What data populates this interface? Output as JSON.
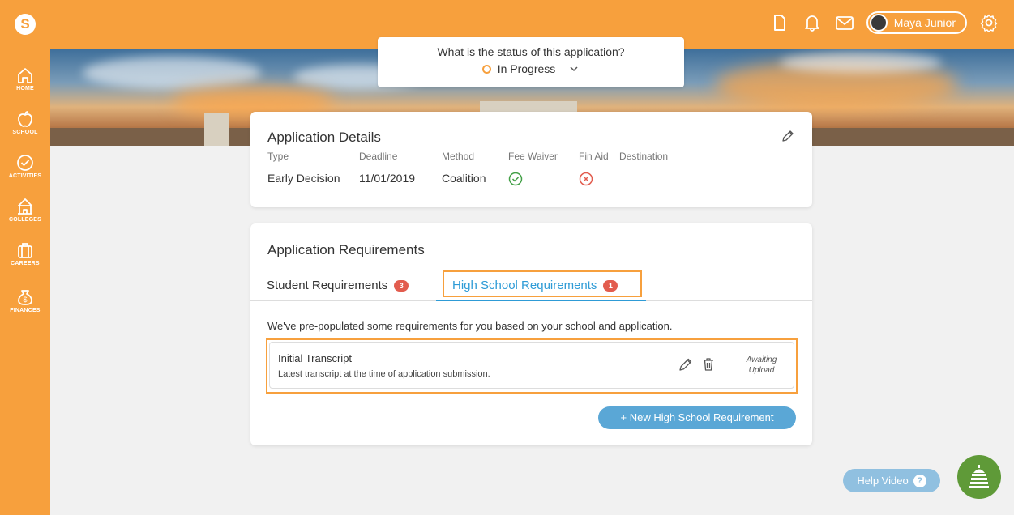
{
  "header": {
    "logo_letter": "S",
    "user_name": "Maya Junior",
    "icons": [
      "document-icon",
      "bell-icon",
      "mail-icon",
      "gear-icon"
    ]
  },
  "sidebar": {
    "items": [
      {
        "label": "HOME",
        "icon": "home-icon"
      },
      {
        "label": "SCHOOL",
        "icon": "apple-icon"
      },
      {
        "label": "ACTIVITIES",
        "icon": "check-circle-icon"
      },
      {
        "label": "COLLEGES",
        "icon": "college-icon"
      },
      {
        "label": "CAREERS",
        "icon": "briefcase-icon"
      },
      {
        "label": "FINANCES",
        "icon": "money-bag-icon"
      }
    ]
  },
  "status": {
    "question": "What is the status of this application?",
    "value": "In Progress"
  },
  "details": {
    "title": "Application Details",
    "columns": {
      "type": {
        "header": "Type",
        "value": "Early Decision"
      },
      "deadline": {
        "header": "Deadline",
        "value": "11/01/2019"
      },
      "method": {
        "header": "Method",
        "value": "Coalition"
      },
      "fee_waiver": {
        "header": "Fee Waiver",
        "value": "yes"
      },
      "fin_aid": {
        "header": "Fin Aid",
        "value": "no"
      },
      "destination": {
        "header": "Destination",
        "value": ""
      }
    }
  },
  "requirements": {
    "title": "Application Requirements",
    "tabs": [
      {
        "label": "Student Requirements",
        "count": "3"
      },
      {
        "label": "High School Requirements",
        "count": "1"
      }
    ],
    "note": "We've pre-populated some requirements for you based on your school and application.",
    "items": [
      {
        "name": "Initial Transcript",
        "description": "Latest transcript at the time of application submission.",
        "status_line1": "Awaiting",
        "status_line2": "Upload"
      }
    ],
    "new_button": "+ New High School Requirement"
  },
  "help": {
    "label": "Help Video",
    "q": "?"
  },
  "colors": {
    "brand_orange": "#f7a03d",
    "accent_blue": "#2e9bd6",
    "badge_red": "#e25c4e",
    "success_green": "#43a047"
  }
}
